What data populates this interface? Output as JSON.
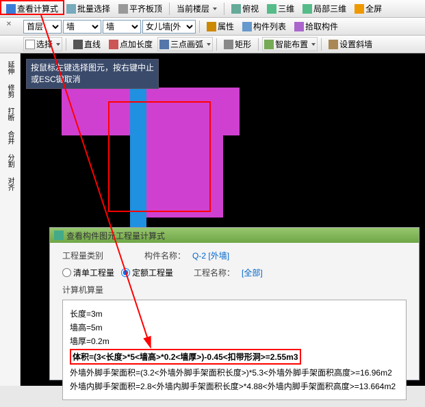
{
  "toolbar1": {
    "viewFormula": "查看计算式",
    "batchSelect": "批量选择",
    "alignTop": "平齐板顶",
    "currentFloor": "当前楼层",
    "topView": "俯视",
    "threeD": "三维",
    "localThreeD": "局部三维",
    "fullScreen": "全屏"
  },
  "toolbar2": {
    "floor": "首层",
    "cat1": "墙",
    "cat2": "墙",
    "cat3": "女儿墙[外",
    "attr": "属性",
    "compList": "构件列表",
    "pick": "拾取构件"
  },
  "toolbar3": {
    "select": "选择",
    "line": "直线",
    "addLen": "点加长度",
    "arc3": "三点画弧",
    "rect": "矩形",
    "smart": "智能布置",
    "slope": "设置斜墙"
  },
  "left": {
    "extend": "延伸",
    "trim": "修剪",
    "break": "打断",
    "merge": "合并",
    "split": "分割",
    "align": "对齐"
  },
  "hint": {
    "l1": "按鼠标左键选择图元，按右键中止",
    "l2": "或ESC键取消"
  },
  "panel": {
    "title": "查看构件图元工程量计算式",
    "catLabel": "工程量类别",
    "r1": "清单工程量",
    "r2": "定额工程量",
    "compNameLbl": "构件名称：",
    "compName": "Q-2 [外墙]",
    "projNameLbl": "工程名称：",
    "projName": "[全部]",
    "calcLabel": "计算机算量",
    "length": "长度=3m",
    "height": "墙高=5m",
    "thick": "墙厚=0.2m",
    "volume": "体积=(3<长度>*5<墙高>*0.2<墙厚>)-0.45<扣带形洞>=2.55m3",
    "outerArea": "外墙外脚手架面积=(3.2<外墙外脚手架面积长度>)*5.3<外墙外脚手架面积高度>=16.96m2",
    "innerArea": "外墙内脚手架面积=2.8<外墙内脚手架面积长度>*4.88<外墙内脚手架面积高度>=13.664m2"
  }
}
